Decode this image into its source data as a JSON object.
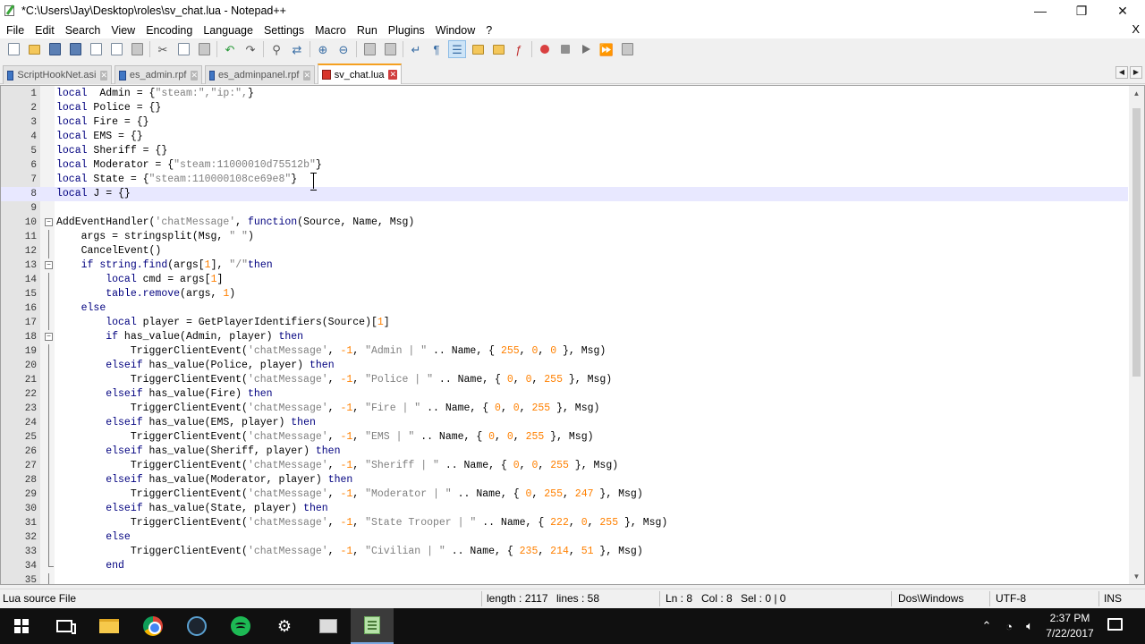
{
  "window": {
    "title": "*C:\\Users\\Jay\\Desktop\\roles\\sv_chat.lua - Notepad++",
    "minimize": "—",
    "restore": "❐",
    "close": "✕"
  },
  "menu": {
    "items": [
      "File",
      "Edit",
      "Search",
      "View",
      "Encoding",
      "Language",
      "Settings",
      "Macro",
      "Run",
      "Plugins",
      "Window",
      "?"
    ],
    "close_doc": "X"
  },
  "tabs": [
    {
      "label": "ScriptHookNet.asi",
      "icon": "saved-disk-icon"
    },
    {
      "label": "es_admin.rpf",
      "icon": "saved-disk-icon"
    },
    {
      "label": "es_adminpanel.rpf",
      "icon": "saved-disk-icon"
    },
    {
      "label": "sv_chat.lua",
      "icon": "modified-disk-icon",
      "active": true
    }
  ],
  "editor": {
    "current_line": 8,
    "lines": [
      {
        "n": "1",
        "fold": "",
        "tokens": [
          [
            "kw",
            "local"
          ],
          [
            "",
            "  Admin = {"
          ],
          [
            "str",
            "\"steam:\",\"ip:\","
          ],
          [
            "",
            "}"
          ]
        ]
      },
      {
        "n": "2",
        "fold": "",
        "tokens": [
          [
            "kw",
            "local"
          ],
          [
            "",
            " Police = {}"
          ]
        ]
      },
      {
        "n": "3",
        "fold": "",
        "tokens": [
          [
            "kw",
            "local"
          ],
          [
            "",
            " Fire = {}"
          ]
        ]
      },
      {
        "n": "4",
        "fold": "",
        "tokens": [
          [
            "kw",
            "local"
          ],
          [
            "",
            " EMS = {}"
          ]
        ]
      },
      {
        "n": "5",
        "fold": "",
        "tokens": [
          [
            "kw",
            "local"
          ],
          [
            "",
            " Sheriff = {}"
          ]
        ]
      },
      {
        "n": "6",
        "fold": "",
        "tokens": [
          [
            "kw",
            "local"
          ],
          [
            "",
            " Moderator = {"
          ],
          [
            "str",
            "\"steam:11000010d75512b\""
          ],
          [
            "",
            "}"
          ]
        ]
      },
      {
        "n": "7",
        "fold": "",
        "tokens": [
          [
            "kw",
            "local"
          ],
          [
            "",
            " State = {"
          ],
          [
            "str",
            "\"steam:110000108ce69e8\""
          ],
          [
            "",
            "}"
          ]
        ]
      },
      {
        "n": "8",
        "fold": "",
        "tokens": [
          [
            "kw",
            "local"
          ],
          [
            "",
            " J = {}"
          ]
        ]
      },
      {
        "n": "9",
        "fold": "",
        "tokens": []
      },
      {
        "n": "10",
        "fold": "open",
        "tokens": [
          [
            "",
            "AddEventHandler("
          ],
          [
            "str",
            "'chatMessage'"
          ],
          [
            "",
            ", "
          ],
          [
            "kw",
            "function"
          ],
          [
            "",
            "(Source, Name, Msg)"
          ]
        ]
      },
      {
        "n": "11",
        "fold": "line",
        "tokens": [
          [
            "",
            "    args = stringsplit(Msg, "
          ],
          [
            "str",
            "\" \""
          ],
          [
            "",
            ")"
          ]
        ]
      },
      {
        "n": "12",
        "fold": "line",
        "tokens": [
          [
            "",
            "    CancelEvent()"
          ]
        ]
      },
      {
        "n": "13",
        "fold": "open",
        "tokens": [
          [
            "",
            "    "
          ],
          [
            "kw",
            "if"
          ],
          [
            "",
            " "
          ],
          [
            "kw",
            "string.find"
          ],
          [
            "",
            "(args["
          ],
          [
            "num",
            "1"
          ],
          [
            "",
            "], "
          ],
          [
            "str",
            "\"/\""
          ],
          [
            ") "
          ],
          [
            "kw",
            "then"
          ]
        ]
      },
      {
        "n": "14",
        "fold": "line",
        "tokens": [
          [
            "",
            "        "
          ],
          [
            "kw",
            "local"
          ],
          [
            "",
            " cmd = args["
          ],
          [
            "num",
            "1"
          ],
          [
            "",
            "]"
          ]
        ]
      },
      {
        "n": "15",
        "fold": "line",
        "tokens": [
          [
            "",
            "        "
          ],
          [
            "kw",
            "table.remove"
          ],
          [
            "",
            "(args, "
          ],
          [
            "num",
            "1"
          ],
          [
            "",
            ")"
          ]
        ]
      },
      {
        "n": "16",
        "fold": "line",
        "tokens": [
          [
            "",
            "    "
          ],
          [
            "kw",
            "else"
          ]
        ]
      },
      {
        "n": "17",
        "fold": "line",
        "tokens": [
          [
            "",
            "        "
          ],
          [
            "kw",
            "local"
          ],
          [
            "",
            " player = GetPlayerIdentifiers(Source)["
          ],
          [
            "num",
            "1"
          ],
          [
            "",
            "]"
          ]
        ]
      },
      {
        "n": "18",
        "fold": "open",
        "tokens": [
          [
            "",
            "        "
          ],
          [
            "kw",
            "if"
          ],
          [
            "",
            " has_value(Admin, player) "
          ],
          [
            "kw",
            "then"
          ]
        ]
      },
      {
        "n": "19",
        "fold": "line",
        "tokens": [
          [
            "",
            "            TriggerClientEvent("
          ],
          [
            "str",
            "'chatMessage'"
          ],
          [
            "",
            ", "
          ],
          [
            "num",
            "-1"
          ],
          [
            "",
            ", "
          ],
          [
            "str",
            "\"Admin | \""
          ],
          [
            "",
            " .. Name, { "
          ],
          [
            "num",
            "255"
          ],
          [
            "",
            ", "
          ],
          [
            "num",
            "0"
          ],
          [
            "",
            ", "
          ],
          [
            "num",
            "0"
          ],
          [
            "",
            " }, Msg)"
          ]
        ]
      },
      {
        "n": "20",
        "fold": "line",
        "tokens": [
          [
            "",
            "        "
          ],
          [
            "kw",
            "elseif"
          ],
          [
            "",
            " has_value(Police, player) "
          ],
          [
            "kw",
            "then"
          ]
        ]
      },
      {
        "n": "21",
        "fold": "line",
        "tokens": [
          [
            "",
            "            TriggerClientEvent("
          ],
          [
            "str",
            "'chatMessage'"
          ],
          [
            "",
            ", "
          ],
          [
            "num",
            "-1"
          ],
          [
            "",
            ", "
          ],
          [
            "str",
            "\"Police | \""
          ],
          [
            "",
            " .. Name, { "
          ],
          [
            "num",
            "0"
          ],
          [
            "",
            ", "
          ],
          [
            "num",
            "0"
          ],
          [
            "",
            ", "
          ],
          [
            "num",
            "255"
          ],
          [
            "",
            " }, Msg)"
          ]
        ]
      },
      {
        "n": "22",
        "fold": "line",
        "tokens": [
          [
            "",
            "        "
          ],
          [
            "kw",
            "elseif"
          ],
          [
            "",
            " has_value(Fire) "
          ],
          [
            "kw",
            "then"
          ]
        ]
      },
      {
        "n": "23",
        "fold": "line",
        "tokens": [
          [
            "",
            "            TriggerClientEvent("
          ],
          [
            "str",
            "'chatMessage'"
          ],
          [
            "",
            ", "
          ],
          [
            "num",
            "-1"
          ],
          [
            "",
            ", "
          ],
          [
            "str",
            "\"Fire | \""
          ],
          [
            "",
            " .. Name, { "
          ],
          [
            "num",
            "0"
          ],
          [
            "",
            ", "
          ],
          [
            "num",
            "0"
          ],
          [
            "",
            ", "
          ],
          [
            "num",
            "255"
          ],
          [
            "",
            " }, Msg)"
          ]
        ]
      },
      {
        "n": "24",
        "fold": "line",
        "tokens": [
          [
            "",
            "        "
          ],
          [
            "kw",
            "elseif"
          ],
          [
            "",
            " has_value(EMS, player) "
          ],
          [
            "kw",
            "then"
          ]
        ]
      },
      {
        "n": "25",
        "fold": "line",
        "tokens": [
          [
            "",
            "            TriggerClientEvent("
          ],
          [
            "str",
            "'chatMessage'"
          ],
          [
            "",
            ", "
          ],
          [
            "num",
            "-1"
          ],
          [
            "",
            ", "
          ],
          [
            "str",
            "\"EMS | \""
          ],
          [
            "",
            " .. Name, { "
          ],
          [
            "num",
            "0"
          ],
          [
            "",
            ", "
          ],
          [
            "num",
            "0"
          ],
          [
            "",
            ", "
          ],
          [
            "num",
            "255"
          ],
          [
            "",
            " }, Msg)"
          ]
        ]
      },
      {
        "n": "26",
        "fold": "line",
        "tokens": [
          [
            "",
            "        "
          ],
          [
            "kw",
            "elseif"
          ],
          [
            "",
            " has_value(Sheriff, player) "
          ],
          [
            "kw",
            "then"
          ]
        ]
      },
      {
        "n": "27",
        "fold": "line",
        "tokens": [
          [
            "",
            "            TriggerClientEvent("
          ],
          [
            "str",
            "'chatMessage'"
          ],
          [
            "",
            ", "
          ],
          [
            "num",
            "-1"
          ],
          [
            "",
            ", "
          ],
          [
            "str",
            "\"Sheriff | \""
          ],
          [
            "",
            " .. Name, { "
          ],
          [
            "num",
            "0"
          ],
          [
            "",
            ", "
          ],
          [
            "num",
            "0"
          ],
          [
            "",
            ", "
          ],
          [
            "num",
            "255"
          ],
          [
            "",
            " }, Msg)"
          ]
        ]
      },
      {
        "n": "28",
        "fold": "line",
        "tokens": [
          [
            "",
            "        "
          ],
          [
            "kw",
            "elseif"
          ],
          [
            "",
            " has_value(Moderator, player) "
          ],
          [
            "kw",
            "then"
          ]
        ]
      },
      {
        "n": "29",
        "fold": "line",
        "tokens": [
          [
            "",
            "            TriggerClientEvent("
          ],
          [
            "str",
            "'chatMessage'"
          ],
          [
            "",
            ", "
          ],
          [
            "num",
            "-1"
          ],
          [
            "",
            ", "
          ],
          [
            "str",
            "\"Moderator | \""
          ],
          [
            "",
            " .. Name, { "
          ],
          [
            "num",
            "0"
          ],
          [
            "",
            ", "
          ],
          [
            "num",
            "255"
          ],
          [
            "",
            ", "
          ],
          [
            "num",
            "247"
          ],
          [
            "",
            " }, Msg)"
          ]
        ]
      },
      {
        "n": "30",
        "fold": "line",
        "tokens": [
          [
            "",
            "        "
          ],
          [
            "kw",
            "elseif"
          ],
          [
            "",
            " has_value(State, player) "
          ],
          [
            "kw",
            "then"
          ]
        ]
      },
      {
        "n": "31",
        "fold": "line",
        "tokens": [
          [
            "",
            "            TriggerClientEvent("
          ],
          [
            "str",
            "'chatMessage'"
          ],
          [
            "",
            ", "
          ],
          [
            "num",
            "-1"
          ],
          [
            "",
            ", "
          ],
          [
            "str",
            "\"State Trooper | \""
          ],
          [
            "",
            " .. Name, { "
          ],
          [
            "num",
            "222"
          ],
          [
            "",
            ", "
          ],
          [
            "num",
            "0"
          ],
          [
            "",
            ", "
          ],
          [
            "num",
            "255"
          ],
          [
            "",
            " }, Msg)"
          ]
        ]
      },
      {
        "n": "32",
        "fold": "line",
        "tokens": [
          [
            "",
            "        "
          ],
          [
            "kw",
            "else"
          ]
        ]
      },
      {
        "n": "33",
        "fold": "line",
        "tokens": [
          [
            "",
            "            TriggerClientEvent("
          ],
          [
            "str",
            "'chatMessage'"
          ],
          [
            "",
            ", "
          ],
          [
            "num",
            "-1"
          ],
          [
            "",
            ", "
          ],
          [
            "str",
            "\"Civilian | \""
          ],
          [
            "",
            " .. Name, { "
          ],
          [
            "num",
            "235"
          ],
          [
            "",
            ", "
          ],
          [
            "num",
            "214"
          ],
          [
            "",
            ", "
          ],
          [
            "num",
            "51"
          ],
          [
            "",
            " }, Msg)"
          ]
        ]
      },
      {
        "n": "34",
        "fold": "end",
        "tokens": [
          [
            "",
            "        "
          ],
          [
            "kw",
            "end"
          ]
        ]
      },
      {
        "n": "35",
        "fold": "line",
        "tokens": []
      }
    ]
  },
  "status": {
    "file_type": "Lua source File",
    "length": "length : 2117",
    "lines": "lines : 58",
    "ln": "Ln : 8",
    "col": "Col : 8",
    "sel": "Sel : 0 | 0",
    "eol": "Dos\\Windows",
    "encoding": "UTF-8",
    "mode": "INS"
  },
  "taskbar": {
    "time": "2:37 PM",
    "date": "7/22/2017",
    "apps": [
      "file-explorer-icon",
      "chrome-icon",
      "media-app-icon",
      "spotify-icon",
      "steam-icon",
      "cards-app-icon",
      "notepadpp-icon"
    ]
  },
  "colors": {
    "keyword": "#00007f",
    "string": "#7f7f7f",
    "number": "#ff8000",
    "current_line": "#e8e8ff",
    "active_tab_accent": "#f5a020"
  }
}
